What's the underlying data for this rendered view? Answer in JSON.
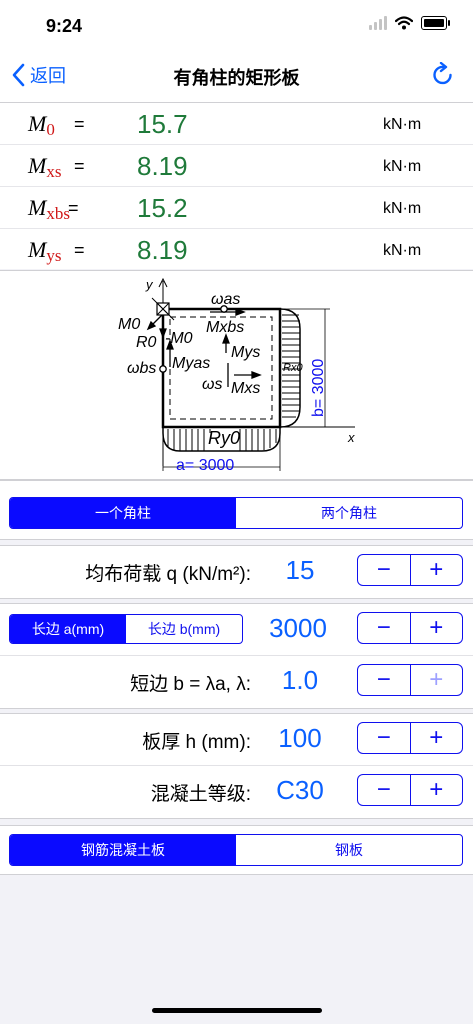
{
  "status_bar": {
    "time": "9:24"
  },
  "nav": {
    "back_label": "返回",
    "title": "有角柱的矩形板"
  },
  "results": [
    {
      "symbol": "M",
      "subscript": "0",
      "equals": "=",
      "value": "15.7",
      "unit": "kN·m"
    },
    {
      "symbol": "M",
      "subscript": "xs",
      "equals": "=",
      "value": "8.19",
      "unit": "kN·m"
    },
    {
      "symbol": "M",
      "subscript": "xbs",
      "equals": "=",
      "value": "15.2",
      "unit": "kN·m"
    },
    {
      "symbol": "M",
      "subscript": "ys",
      "equals": "=",
      "value": "8.19",
      "unit": "kN·m"
    }
  ],
  "diagram": {
    "labels": {
      "y_axis": "y",
      "x_axis": "x",
      "M0": "M0",
      "R0": "R0",
      "neg_M0": "-M0",
      "omega_as": "ωas",
      "Mxbs": "Mxbs",
      "Mys": "Mys",
      "Rx0": "Rx0",
      "omega_bs": "ωbs",
      "Myas": "Myas",
      "omega_s": "ωs",
      "Mxs": "Mxs",
      "Ry0": "Ry0",
      "b_dim": "b=  3000",
      "a_dim": "a=  3000"
    }
  },
  "column_mode": {
    "options": [
      "一个角柱",
      "两个角柱"
    ],
    "selected": 0
  },
  "load": {
    "label": "均布荷载  q (kN/m²):",
    "value": "15",
    "minus": "−",
    "plus": "+"
  },
  "side_mode": {
    "options": [
      "长边 a(mm)",
      "长边 b(mm)"
    ],
    "selected": 0
  },
  "long_side": {
    "value": "3000",
    "minus": "−",
    "plus": "+"
  },
  "short_side": {
    "label": "短边  b = λa,  λ:",
    "value": "1.0",
    "minus": "−",
    "plus": "+",
    "plus_enabled": false
  },
  "thickness": {
    "label": "板厚  h (mm):",
    "value": "100",
    "minus": "−",
    "plus": "+"
  },
  "concrete": {
    "label": "混凝土等级:",
    "value": "C30",
    "minus": "−",
    "plus": "+"
  },
  "material_mode": {
    "options": [
      "钢筋混凝土板",
      "钢板"
    ],
    "selected": 0
  },
  "colors": {
    "accent": "#0a60ff",
    "segment": "#0a0aff",
    "result_value": "#1f7a3a",
    "subscript": "#d01818"
  }
}
